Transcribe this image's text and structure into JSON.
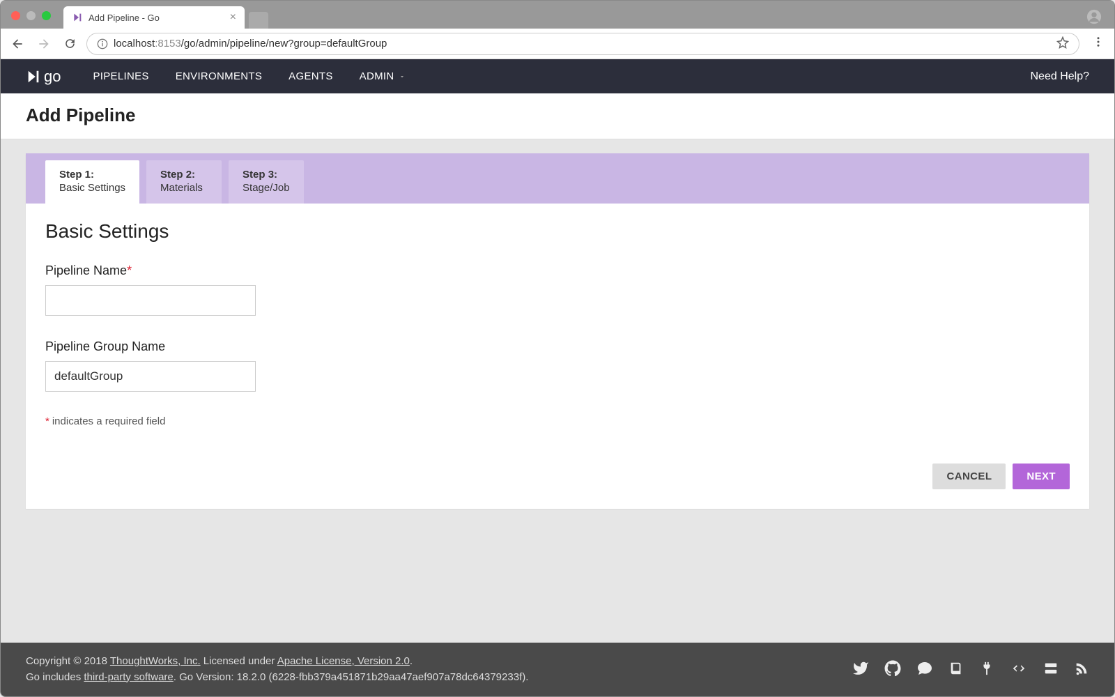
{
  "browser": {
    "tab_title": "Add Pipeline - Go",
    "url_host": "localhost",
    "url_port": ":8153",
    "url_path": "/go/admin/pipeline/new?group=defaultGroup"
  },
  "nav": {
    "items": [
      "PIPELINES",
      "ENVIRONMENTS",
      "AGENTS",
      "ADMIN"
    ],
    "help": "Need Help?"
  },
  "page": {
    "title": "Add Pipeline"
  },
  "wizard": {
    "steps": [
      {
        "num": "Step 1:",
        "label": "Basic Settings"
      },
      {
        "num": "Step 2:",
        "label": "Materials"
      },
      {
        "num": "Step 3:",
        "label": "Stage/Job"
      }
    ],
    "section_title": "Basic Settings",
    "fields": {
      "pipeline_name_label": "Pipeline Name",
      "pipeline_name_value": "",
      "group_name_label": "Pipeline Group Name",
      "group_name_value": "defaultGroup"
    },
    "required_note": "indicates a required field",
    "cancel": "CANCEL",
    "next": "NEXT"
  },
  "footer": {
    "copyright_prefix": "Copyright © 2018 ",
    "company": "ThoughtWorks, Inc.",
    "licensed": " Licensed under ",
    "license": "Apache License, Version 2.0",
    "period": ".",
    "line2_prefix": "Go includes ",
    "third_party": "third-party software",
    "version": ". Go Version: 18.2.0 (6228-fbb379a451871b29aa47aef907a78dc64379233f)."
  }
}
